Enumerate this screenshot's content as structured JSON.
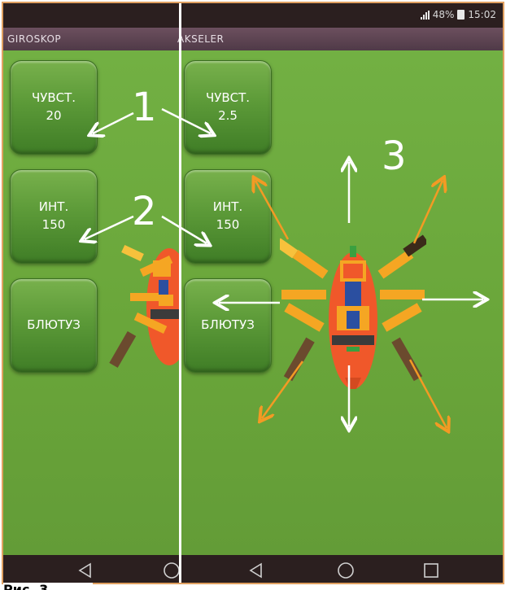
{
  "status_bar": {
    "battery": "48%",
    "time": "15:02"
  },
  "tabs": {
    "left": "GIROSKOP",
    "right": "AKSELER"
  },
  "left_panel": {
    "sensitivity": {
      "label": "ЧУВСТ.",
      "value": "20"
    },
    "interval": {
      "label": "ИНТ.",
      "value": "150"
    },
    "bluetooth": {
      "label": "БЛЮТУЗ"
    }
  },
  "right_panel": {
    "sensitivity": {
      "label": "ЧУВСТ.",
      "value": "2.5"
    },
    "interval": {
      "label": "ИНТ.",
      "value": "150"
    },
    "bluetooth": {
      "label": "БЛЮТУЗ"
    }
  },
  "annotations": {
    "one": "1",
    "two": "2",
    "three": "3"
  },
  "caption": "Рис. 3",
  "colors": {
    "accent": "#f39a24",
    "background": "#6aa63a",
    "bars": "#2b1f1f",
    "title": "#5e4552",
    "robot_body": "#f0582a"
  },
  "icons": [
    "back-icon",
    "home-icon",
    "recent-apps-icon",
    "signal-icon",
    "battery-icon"
  ]
}
